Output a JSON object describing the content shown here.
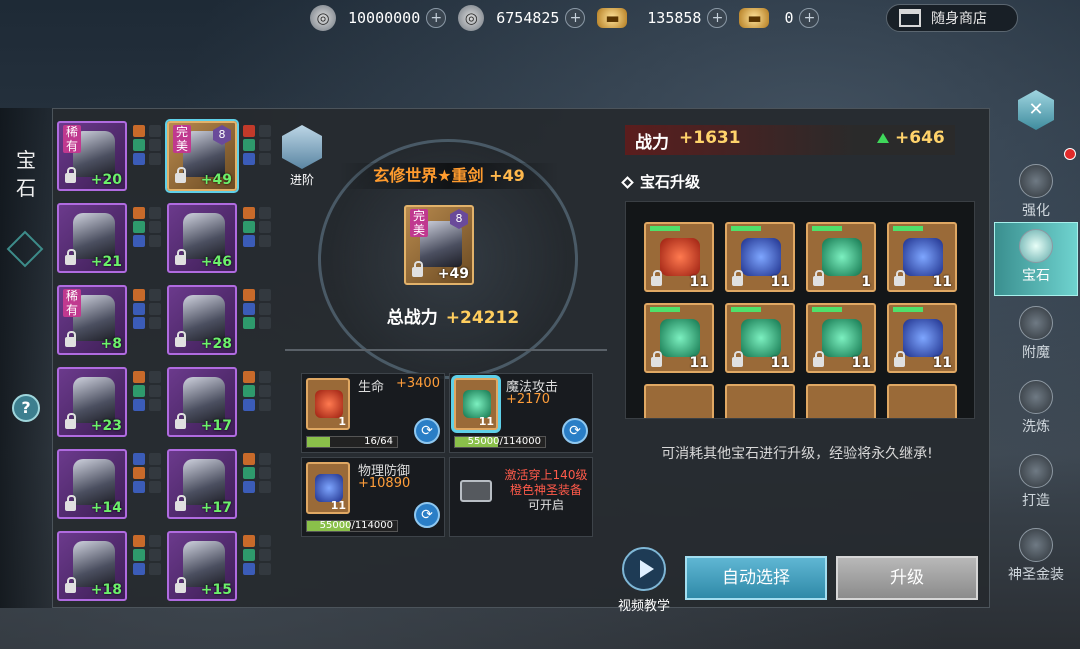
{
  "currencies": [
    {
      "icon": "silver-coin-icon",
      "value": "10000000"
    },
    {
      "icon": "locked-silver-coin-icon",
      "value": "6754825"
    },
    {
      "icon": "gold-ingot-icon",
      "value": "135858"
    },
    {
      "icon": "locked-gold-ingot-icon",
      "value": "0"
    }
  ],
  "plus_symbol": "+",
  "shop_label": "随身商店",
  "left_title": "宝石",
  "help_label": "?",
  "advance_label": "进阶",
  "equipment_slots": [
    {
      "rarity": "稀有",
      "level": "+20",
      "frame": "purple"
    },
    {
      "rarity": "完美",
      "level": "+49",
      "frame": "gold",
      "stars": "8"
    },
    {
      "rarity": "",
      "level": "+21",
      "frame": "purple"
    },
    {
      "rarity": "",
      "level": "+46",
      "frame": "purple"
    },
    {
      "rarity": "稀有",
      "level": "+8",
      "frame": "purple"
    },
    {
      "rarity": "",
      "level": "+28",
      "frame": "purple"
    },
    {
      "rarity": "",
      "level": "+23",
      "frame": "purple"
    },
    {
      "rarity": "",
      "level": "+17",
      "frame": "purple"
    },
    {
      "rarity": "",
      "level": "+14",
      "frame": "purple"
    },
    {
      "rarity": "",
      "level": "+17",
      "frame": "purple"
    },
    {
      "rarity": "",
      "level": "+18",
      "frame": "purple"
    },
    {
      "rarity": "",
      "level": "+15",
      "frame": "purple"
    }
  ],
  "selected_item": {
    "name": "玄修世界★重剑",
    "plus": "+49",
    "rarity": "完美",
    "stars": "8",
    "total_power_label": "总战力",
    "total_power": "+24212"
  },
  "gem_sockets": [
    {
      "attr": "生命",
      "value": "+3400",
      "progress": "16/64",
      "progress_fraction": 0.25,
      "color": "red",
      "count": "1"
    },
    {
      "attr": "魔法攻击",
      "value": "+2170",
      "progress": "55000/114000",
      "progress_fraction": 0.48,
      "color": "green",
      "count": "11"
    },
    {
      "attr": "物理防御",
      "value": "+10890",
      "progress": "55000/114000",
      "progress_fraction": 0.48,
      "color": "blue",
      "count": "11"
    }
  ],
  "locked_socket": {
    "requirement": "激活穿上140级橙色神圣装备",
    "suffix": "可开启"
  },
  "power": {
    "label": "战力",
    "value": "+1631",
    "delta": "+646"
  },
  "upgrade_title": "宝石升级",
  "gem_grid": [
    {
      "color": "red",
      "count": "11"
    },
    {
      "color": "blue",
      "count": "11"
    },
    {
      "color": "green",
      "count": "1"
    },
    {
      "color": "blue",
      "count": "11"
    },
    {
      "color": "green",
      "count": "11"
    },
    {
      "color": "green",
      "count": "11"
    },
    {
      "color": "green",
      "count": "11"
    },
    {
      "color": "blue",
      "count": "11"
    }
  ],
  "hint": "可消耗其他宝石进行升级，经验将永久继承!",
  "video_label": "视频教学",
  "auto_select_label": "自动选择",
  "upgrade_label": "升级",
  "nav": [
    {
      "label": "强化",
      "icon": "enhance-icon",
      "active": false
    },
    {
      "label": "宝石",
      "icon": "gem-icon",
      "active": true
    },
    {
      "label": "附魔",
      "icon": "enchant-icon",
      "active": false
    },
    {
      "label": "洗炼",
      "icon": "refine-icon",
      "active": false
    },
    {
      "label": "打造",
      "icon": "forge-icon",
      "active": false
    },
    {
      "label": "神圣金装",
      "icon": "holy-gold-armor-icon",
      "active": false
    }
  ]
}
